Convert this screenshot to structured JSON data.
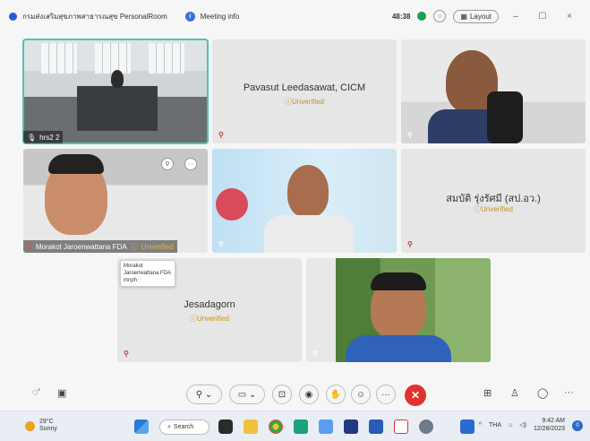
{
  "titlebar": {
    "room_title": "กรมส่งเสริมสุขภาพสาธารณสุข PersonalRoom",
    "meeting_info": "Meeting info",
    "timer": "48:38",
    "layout_label": "Layout",
    "minimize": "–",
    "maximize": "☐",
    "close": "×"
  },
  "tiles": [
    {
      "label": "hrs2 2",
      "name": ""
    },
    {
      "name": "Pavasut Leedasawat, CICM",
      "status": "Unverified"
    },
    {
      "name": ""
    },
    {
      "label": "Morakot Jaroenwattana FDA",
      "status": "Unverified"
    },
    {
      "name": ""
    },
    {
      "name": "สมบัติ รุ่งรัศมี (สป.อว.)",
      "status": "Unverified"
    },
    {
      "name": "Jesadagorn",
      "status": "Unverified"
    },
    {
      "name": ""
    }
  ],
  "tooltip": {
    "line1": "Morakot",
    "line2": "Jaroenwattana FDA",
    "line3": "mnph"
  },
  "toolbar": {
    "mute_icon": "mic-icon",
    "video_icon": "camera-icon",
    "share_icon": "share-icon",
    "record_icon": "record-icon",
    "raise_hand_icon": "hand-icon",
    "reactions_icon": "reactions-icon",
    "more": "···",
    "end": "✕",
    "apps_icon": "apps-icon",
    "participants_icon": "people-icon",
    "chat_icon": "chat-icon"
  },
  "taskbar": {
    "temperature": "29°C",
    "weather_desc": "Sunny",
    "search_label": "Search",
    "lang": "THA",
    "time": "9:42 AM",
    "date": "12/28/2023",
    "notifications": "0"
  }
}
